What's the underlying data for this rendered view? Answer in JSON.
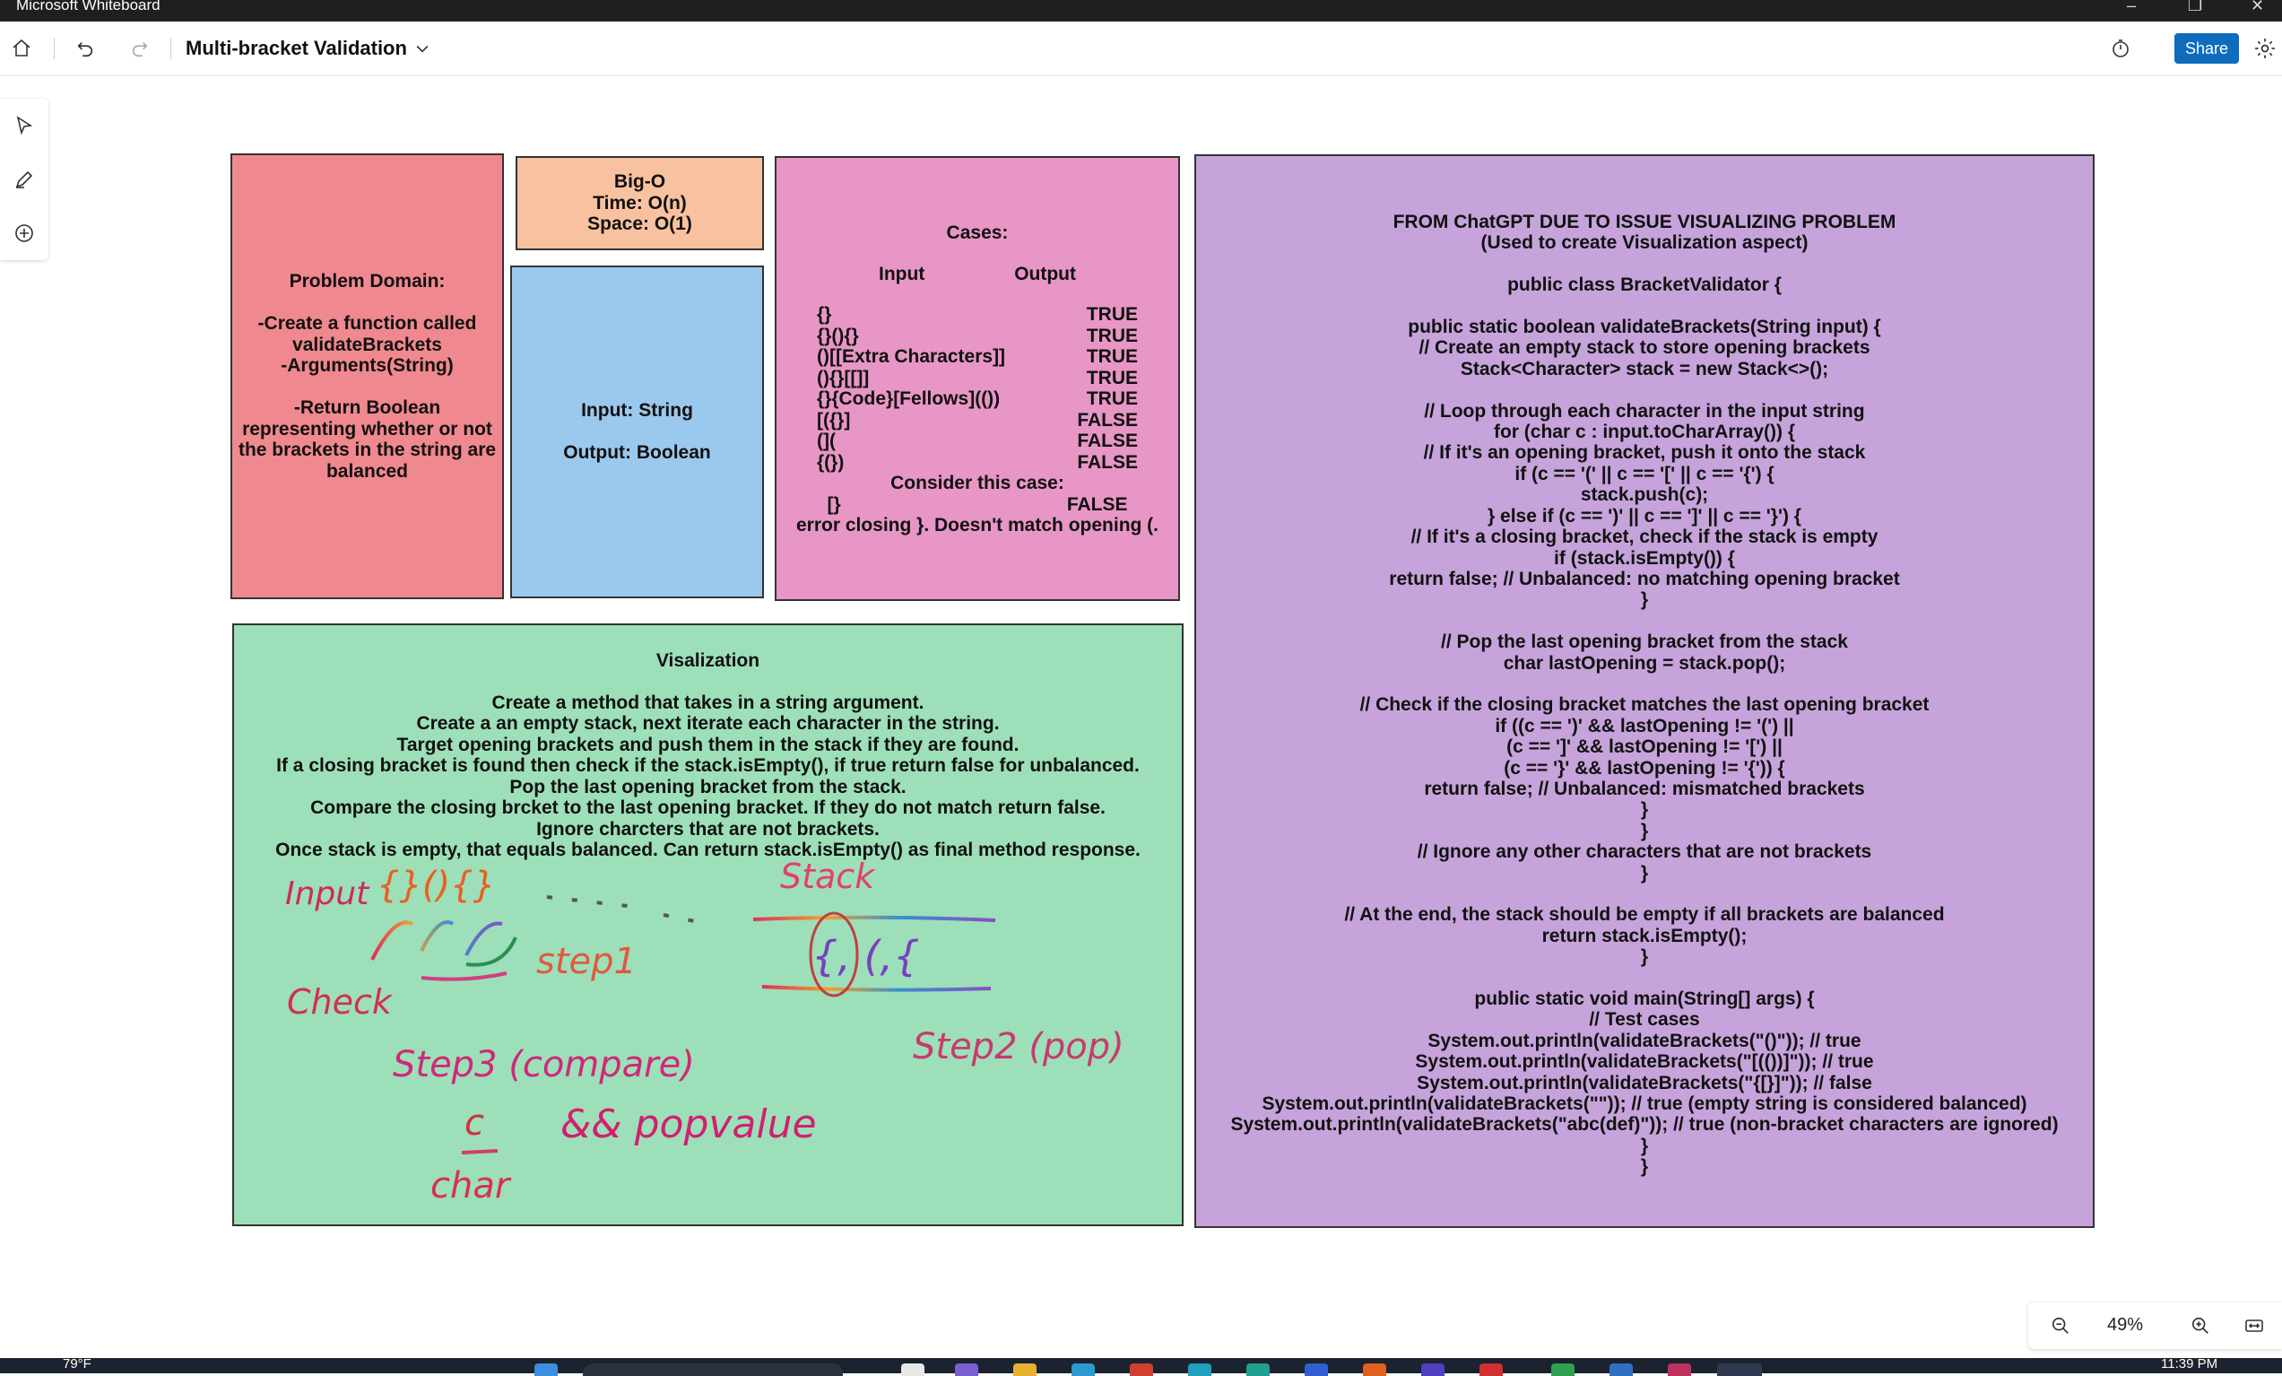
{
  "app": {
    "title": "Microsoft Whiteboard"
  },
  "toolbar": {
    "doc_title": "Multi-bracket Validation",
    "share_label": "Share"
  },
  "notes": {
    "problem": {
      "lines": [
        "Problem Domain:",
        "",
        "-Create a function called",
        "validateBrackets",
        "-Arguments(String)",
        "",
        "-Return Boolean",
        "representing whether or not",
        "the brackets in the string are",
        "balanced"
      ]
    },
    "bigo": {
      "lines": [
        "Big-O",
        "Time: O(n)",
        "Space: O(1)"
      ]
    },
    "io": {
      "lines": [
        "Input: String",
        "",
        "Output: Boolean"
      ]
    },
    "cases": {
      "title": "Cases:",
      "input_header": "Input",
      "output_header": "Output",
      "rows": [
        {
          "input": "{}",
          "output": "TRUE"
        },
        {
          "input": "{}(){}",
          "output": "TRUE"
        },
        {
          "input": "()[[Extra Characters]]",
          "output": "TRUE"
        },
        {
          "input": "(){}[[]]",
          "output": "TRUE"
        },
        {
          "input": "{}{Code}[Fellows](())",
          "output": "TRUE"
        },
        {
          "input": "[({}]",
          "output": "FALSE"
        },
        {
          "input": "(](",
          "output": "FALSE"
        },
        {
          "input": "{(})",
          "output": "FALSE"
        }
      ],
      "consider_label": "Consider this case:",
      "consider_row": {
        "input": "[}",
        "output": "FALSE"
      },
      "consider_note": "error closing }. Doesn't match opening (."
    },
    "visual": {
      "title": "Visalization",
      "lines": [
        "Create a method that takes in a string argument.",
        "Create a an empty stack, next iterate each character in the string.",
        "Target opening brackets and push them in the stack if they are found.",
        "If a closing bracket is found then check if the stack.isEmpty(), if true return false for unbalanced.",
        "Pop the last opening bracket from the stack.",
        "Compare the closing brcket to the last opening bracket. If they do not match return false.",
        "Ignore charcters that are not brackets.",
        "Once stack is empty, that equals balanced. Can return stack.isEmpty() as final method response."
      ],
      "ink": {
        "input": "Input",
        "input_seq": "{}(){}",
        "stack": "Stack",
        "stack_contents": "{, (,{",
        "check": "Check",
        "step1": "step1",
        "step3": "Step3 (compare)",
        "step2": "Step2 (pop)",
        "pop_value": "&& popvalue",
        "c": "c",
        "char": "char"
      }
    },
    "gpt": {
      "lines": [
        "FROM ChatGPT DUE TO ISSUE VISUALIZING PROBLEM",
        "(Used to create Visualization aspect)",
        "",
        "public class BracketValidator {",
        "",
        "public static boolean validateBrackets(String input) {",
        "// Create an empty stack to store opening brackets",
        "Stack<Character> stack = new Stack<>();",
        "",
        "// Loop through each character in the input string",
        "for (char c : input.toCharArray()) {",
        "// If it's an opening bracket, push it onto the stack",
        "if (c == '(' || c == '[' || c == '{') {",
        "stack.push(c);",
        "} else if (c == ')' || c == ']' || c == '}') {",
        "// If it's a closing bracket, check if the stack is empty",
        "if (stack.isEmpty()) {",
        "return false; // Unbalanced: no matching opening bracket",
        "}",
        "",
        "// Pop the last opening bracket from the stack",
        "char lastOpening = stack.pop();",
        "",
        "// Check if the closing bracket matches the last opening bracket",
        "if ((c == ')' && lastOpening != '(') ||",
        "(c == ']' && lastOpening != '[') ||",
        "(c == '}' && lastOpening != '{')) {",
        "return false; // Unbalanced: mismatched brackets",
        "}",
        "}",
        "// Ignore any other characters that are not brackets",
        "}",
        "",
        "// At the end, the stack should be empty if all brackets are balanced",
        "return stack.isEmpty();",
        "}",
        "",
        "public static void main(String[] args) {",
        "// Test cases",
        "System.out.println(validateBrackets(\"()\")); // true",
        "System.out.println(validateBrackets(\"[(())]\")); // true",
        "System.out.println(validateBrackets(\"{[}]\")); // false",
        "System.out.println(validateBrackets(\"\")); // true (empty string is considered balanced)",
        "System.out.println(validateBrackets(\"abc(def)\")); // true (non-bracket characters are ignored)",
        "}",
        "}"
      ]
    }
  },
  "zoom": {
    "level": "49%"
  },
  "taskbar": {
    "temperature": "79°F",
    "clock": "11:39 PM"
  },
  "colors": {
    "problem": "#f0888f",
    "bigo": "#f8c19f",
    "io": "#9bc8ed",
    "cases": "#e896c6",
    "visual": "#9ddfb9",
    "gpt": "#c6a3da",
    "share": "#0f6cbd"
  }
}
